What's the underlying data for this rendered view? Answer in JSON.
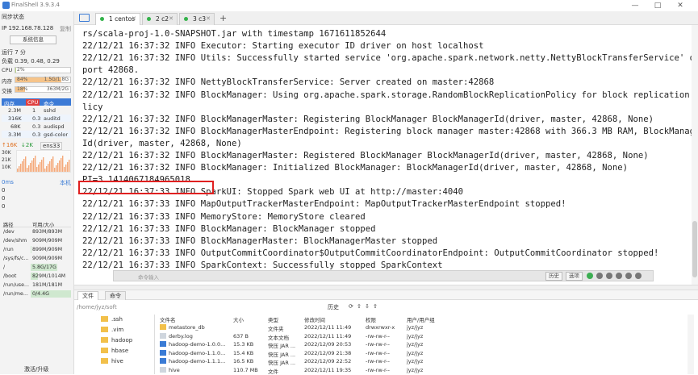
{
  "app": {
    "title": "FinalShell 3.9.3.4",
    "window_controls": [
      "—",
      "□",
      "✕"
    ]
  },
  "sidebar": {
    "sync_status": "同步状态",
    "ip_label": "IP 192.168.78.128",
    "copy_label": "复制",
    "sys_info_button": "系统信息",
    "uptime": "运行 7 分",
    "load": "负载 0.39, 0.48, 0.29",
    "cpu_label": "CPU",
    "cpu_pct": "2%",
    "cpu_value": 0.02,
    "mem_label": "内存",
    "mem_pct": "84%",
    "mem_value_text": "1.5G/1.8G",
    "mem_value": 0.84,
    "swap_label": "交换",
    "swap_pct": "18%",
    "swap_value_text": "363M/2G",
    "swap_value": 0.18,
    "proc_tabs": [
      "内存",
      "CPU",
      "命令"
    ],
    "processes": [
      {
        "mem": "2.3M",
        "cpu": "1",
        "cmd": "sshd"
      },
      {
        "mem": "316K",
        "cpu": "0.3",
        "cmd": "auditd"
      },
      {
        "mem": "68K",
        "cpu": "0.3",
        "cmd": "audispd"
      },
      {
        "mem": "3.3M",
        "cpu": "0.3",
        "cmd": "gsd-color"
      }
    ],
    "net_up": "↑16K",
    "net_down": "↓2K",
    "net_iface": "ens33",
    "net_ticks": [
      "30K",
      "21K",
      "10K"
    ],
    "latency_label": "0ms",
    "latency_host": "本机",
    "latency_values": [
      "0",
      "0",
      "0"
    ],
    "disk_header_path": "路径",
    "disk_header_size": "可用/大小",
    "disks": [
      {
        "path": "/dev",
        "size": "893M/893M",
        "used": 0.0
      },
      {
        "path": "/dev/shm",
        "size": "909M/909M",
        "used": 0.0
      },
      {
        "path": "/run",
        "size": "899M/909M",
        "used": 0.01
      },
      {
        "path": "/sys/fs/c...",
        "size": "909M/909M",
        "used": 0.0
      },
      {
        "path": "/",
        "size": "5.8G/17G",
        "used": 0.66
      },
      {
        "path": "/boot",
        "size": "829M/1014M",
        "used": 0.18
      },
      {
        "path": "/run/use...",
        "size": "181M/181M",
        "used": 0.0
      },
      {
        "path": "/run/me...",
        "size": "0/4.4G",
        "used": 1.0
      }
    ],
    "upgrade_label": "激活/升级"
  },
  "tabs": [
    {
      "label": "1 centos",
      "active": true
    },
    {
      "label": "2 c2",
      "active": false
    },
    {
      "label": "3 c3",
      "active": false
    }
  ],
  "terminal": {
    "lines": [
      "rs/scala-proj-1.0-SNAPSHOT.jar with timestamp 1671611852644",
      "22/12/21 16:37:32 INFO Executor: Starting executor ID driver on host localhost",
      "22/12/21 16:37:32 INFO Utils: Successfully started service 'org.apache.spark.network.netty.NettyBlockTransferService' on",
      "port 42868.",
      "22/12/21 16:37:32 INFO NettyBlockTransferService: Server created on master:42868",
      "22/12/21 16:37:32 INFO BlockManager: Using org.apache.spark.storage.RandomBlockReplicationPolicy for block replication po",
      "licy",
      "22/12/21 16:37:32 INFO BlockManagerMaster: Registering BlockManager BlockManagerId(driver, master, 42868, None)",
      "22/12/21 16:37:32 INFO BlockManagerMasterEndpoint: Registering block manager master:42868 with 366.3 MB RAM, BlockManager",
      "Id(driver, master, 42868, None)",
      "22/12/21 16:37:32 INFO BlockManagerMaster: Registered BlockManager BlockManagerId(driver, master, 42868, None)",
      "22/12/21 16:37:32 INFO BlockManager: Initialized BlockManager: BlockManagerId(driver, master, 42868, None)",
      "PI=3.1414067184965018",
      "22/12/21 16:37:33 INFO SparkUI: Stopped Spark web UI at http://master:4040",
      "22/12/21 16:37:33 INFO MapOutputTrackerMasterEndpoint: MapOutputTrackerMasterEndpoint stopped!",
      "22/12/21 16:37:33 INFO MemoryStore: MemoryStore cleared",
      "22/12/21 16:37:33 INFO BlockManager: BlockManager stopped",
      "22/12/21 16:37:33 INFO BlockManagerMaster: BlockManagerMaster stopped",
      "22/12/21 16:37:33 INFO OutputCommitCoordinator$OutputCommitCoordinatorEndpoint: OutputCommitCoordinator stopped!",
      "22/12/21 16:37:33 INFO SparkContext: Successfully stopped SparkContext"
    ],
    "highlight_color": "#e02020"
  },
  "command_bar": {
    "placeholder": "命令输入",
    "history_button": "历史",
    "options_button": "选项"
  },
  "bottom_tabs": [
    "文件",
    "命令"
  ],
  "file_browser": {
    "path": "/home/jyz/soft",
    "history_button": "历史",
    "tree": [
      ".ssh",
      ".vim",
      "hadoop",
      "hbase",
      "hive"
    ],
    "columns": [
      "文件名",
      "大小",
      "类型",
      "修改时间",
      "权限",
      "用户/用户组"
    ],
    "rows": [
      {
        "name": "metastore_db",
        "size": "",
        "type": "文件夹",
        "modified": "2022/12/11 11:49",
        "perm": "drwxrwxr-x",
        "owner": "jyz/jyz",
        "kind": "folder"
      },
      {
        "name": "derby.log",
        "size": "637 B",
        "type": "文本文档",
        "modified": "2022/12/11 11:49",
        "perm": "-rw-rw-r--",
        "owner": "jyz/jyz",
        "kind": "file"
      },
      {
        "name": "hadoop-demo-1.0.0...",
        "size": "15.3 KB",
        "type": "快压 JAR ...",
        "modified": "2022/12/09 20:53",
        "perm": "-rw-rw-r--",
        "owner": "jyz/jyz",
        "kind": "jar"
      },
      {
        "name": "hadoop-demo-1.1.0...",
        "size": "15.4 KB",
        "type": "快压 JAR ...",
        "modified": "2022/12/09 21:38",
        "perm": "-rw-rw-r--",
        "owner": "jyz/jyz",
        "kind": "jar"
      },
      {
        "name": "hadoop-demo-1.1.1...",
        "size": "16.5 KB",
        "type": "快压 JAR ...",
        "modified": "2022/12/09 22:52",
        "perm": "-rw-rw-r--",
        "owner": "jyz/jyz",
        "kind": "jar"
      },
      {
        "name": "hive",
        "size": "110.7 MB",
        "type": "文件",
        "modified": "2022/12/11 19:35",
        "perm": "-rw-rw-r--",
        "owner": "jyz/jyz",
        "kind": "file"
      }
    ]
  }
}
